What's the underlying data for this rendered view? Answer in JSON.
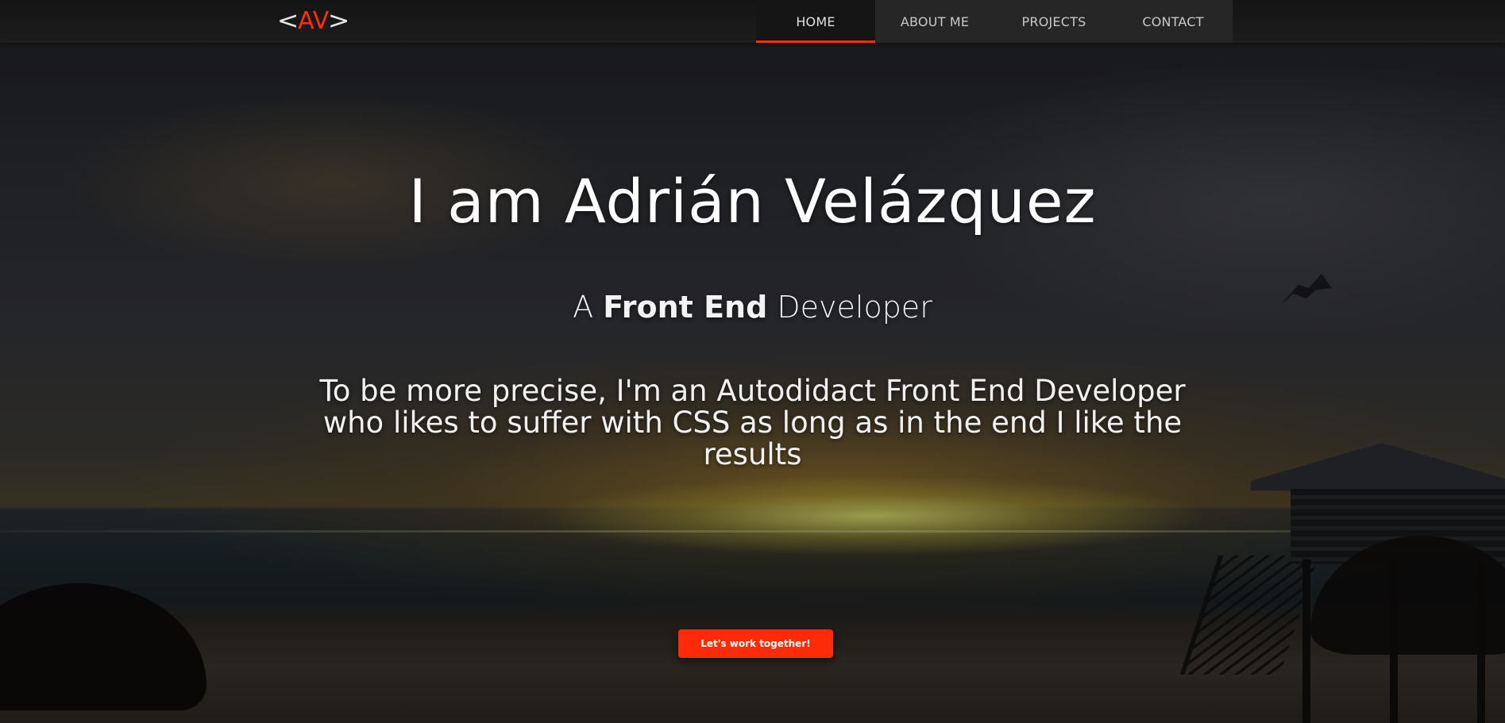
{
  "logo": {
    "left_bracket": "<",
    "initials": "AV",
    "right_bracket": ">"
  },
  "nav": {
    "items": [
      {
        "label": "HOME",
        "active": true
      },
      {
        "label": "ABOUT ME",
        "active": false
      },
      {
        "label": "PROJECTS",
        "active": false
      },
      {
        "label": "CONTACT",
        "active": false
      }
    ]
  },
  "hero": {
    "title": "I am Adrián Velázquez",
    "subtitle": {
      "prefix": "A ",
      "highlight": "Front End",
      "suffix": " Developer"
    },
    "description": "To be more precise, I'm an Autodidact Front End Developer who likes to suffer with CSS as long as in the end I like the results",
    "cta_label": "Let's work together!"
  },
  "colors": {
    "accent": "#ff2e0a",
    "navbar": "#1a1a1a",
    "text": "#ffffff"
  }
}
